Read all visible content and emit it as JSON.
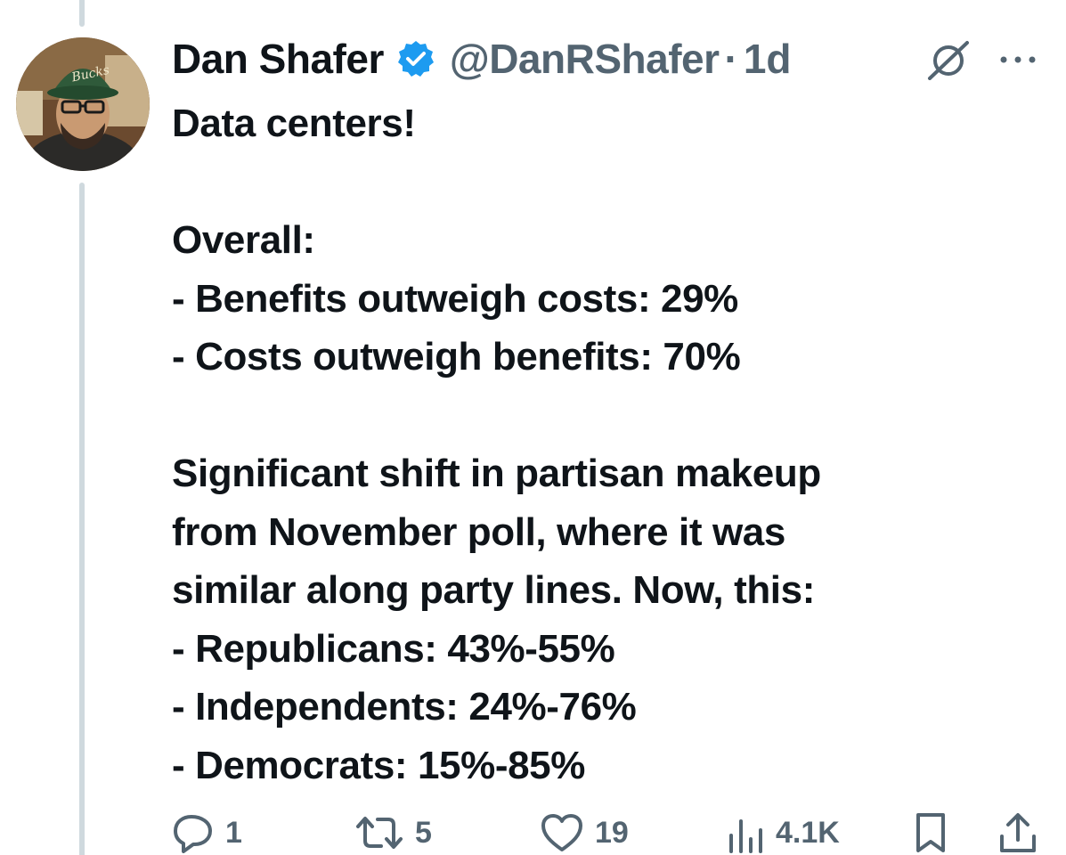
{
  "tweet": {
    "author_name": "Dan Shafer",
    "handle": "@DanRShafer",
    "separator": "·",
    "time": "1d",
    "lines": [
      "Data centers!",
      "",
      "Overall:",
      "- Benefits outweigh costs: 29%",
      "- Costs outweigh benefits: 70%",
      "",
      "Significant shift in partisan makeup",
      "from November poll, where it was",
      "similar along party lines. Now, this:",
      "- Republicans: 43%-55%",
      "- Independents: 24%-76%",
      "- Democrats: 15%-85%"
    ],
    "avatar_cap_text": "Bucks"
  },
  "actions": {
    "replies": "1",
    "reposts": "5",
    "likes": "19",
    "views": "4.1K"
  },
  "icons": {
    "verified": "verified-badge-icon",
    "grok": "grok-icon",
    "more": "more-icon",
    "reply": "reply-icon",
    "repost": "repost-icon",
    "like": "heart-icon",
    "views": "views-icon",
    "bookmark": "bookmark-icon",
    "share": "share-icon"
  },
  "colors": {
    "text": "#0f1419",
    "secondary": "#536471",
    "verified": "#1d9bf0",
    "thread_line": "#cfd9de"
  }
}
